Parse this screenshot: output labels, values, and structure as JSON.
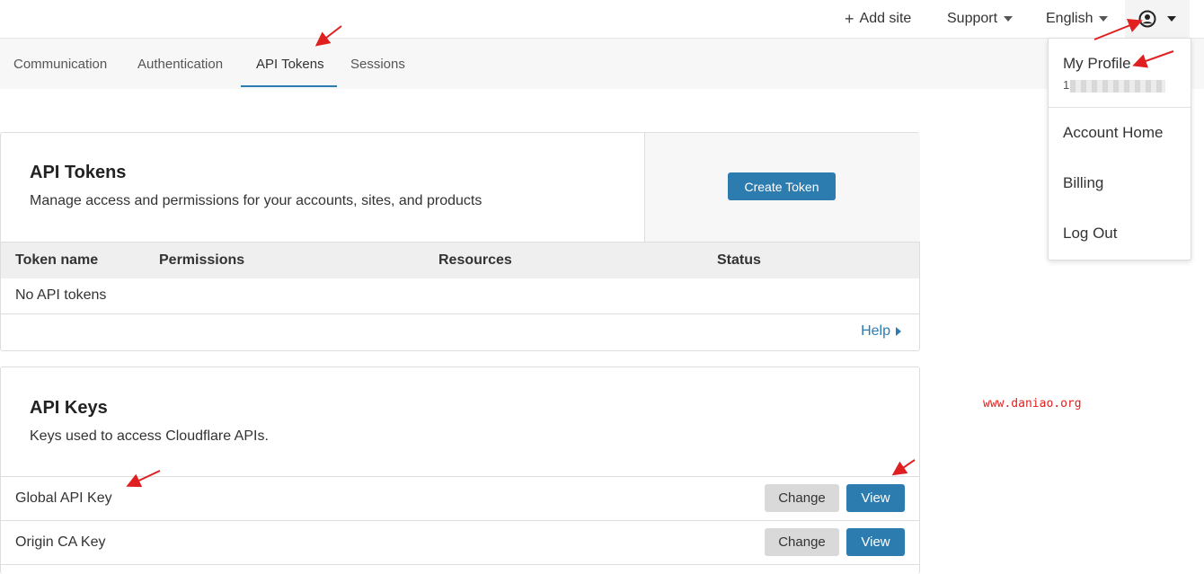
{
  "topbar": {
    "add_site": "Add site",
    "support": "Support",
    "language": "English"
  },
  "tabs": [
    {
      "label": "Communication"
    },
    {
      "label": "Authentication"
    },
    {
      "label": "API Tokens",
      "active": true
    },
    {
      "label": "Sessions"
    }
  ],
  "api_tokens": {
    "title": "API Tokens",
    "description": "Manage access and permissions for your accounts, sites, and products",
    "create_button": "Create Token",
    "columns": [
      "Token name",
      "Permissions",
      "Resources",
      "Status"
    ],
    "empty_text": "No API tokens",
    "help_link": "Help"
  },
  "api_keys": {
    "title": "API Keys",
    "description": "Keys used to access Cloudflare APIs.",
    "rows": [
      {
        "name": "Global API Key",
        "change_label": "Change",
        "view_label": "View"
      },
      {
        "name": "Origin CA Key",
        "change_label": "Change",
        "view_label": "View"
      }
    ]
  },
  "user_menu": {
    "my_profile": "My Profile",
    "email_prefix": "1",
    "items": [
      "Account Home",
      "Billing",
      "Log Out"
    ]
  },
  "watermark": "www.daniao.org",
  "colors": {
    "accent": "#2c7cb0",
    "annotation_arrow": "#e02020"
  },
  "icons": {
    "user": "user-circle-icon",
    "caret": "caret-down-icon",
    "add": "plus-icon",
    "help": "caret-right-icon"
  }
}
